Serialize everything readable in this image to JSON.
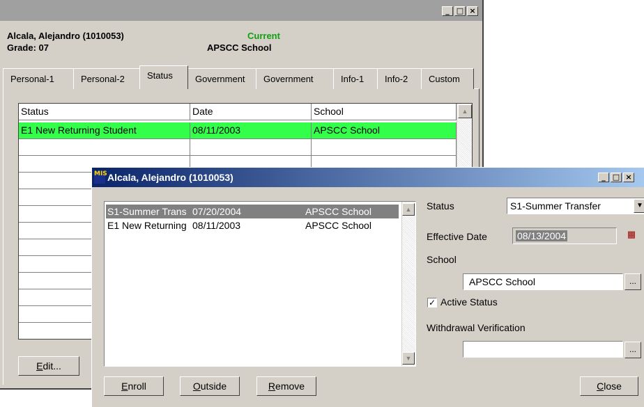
{
  "back_window": {
    "student_name": "Alcala, Alejandro  (1010053)",
    "grade": "Grade: 07",
    "status": "Current",
    "school": "APSCC School",
    "tabs": [
      "Personal-1",
      "Personal-2",
      "Status",
      "Government",
      "Government",
      "Info-1",
      "Info-2",
      "Custom"
    ],
    "active_tab": "Status",
    "grid": {
      "headers": [
        "Status",
        "Date",
        "School"
      ],
      "rows": [
        [
          "E1 New Returning Student",
          "08/11/2003",
          "APSCC School"
        ]
      ],
      "highlight_color": "#33ff4b"
    },
    "edit_button": {
      "underline": "E",
      "rest": "dit..."
    }
  },
  "front_window": {
    "title": "Alcala, Alejandro (1010053)",
    "list": [
      {
        "status": "S1-Summer Trans",
        "date": "07/20/2004",
        "school": "APSCC School",
        "selected": true
      },
      {
        "status": "E1 New Returning",
        "date": "08/11/2003",
        "school": "APSCC School",
        "selected": false
      }
    ],
    "form": {
      "status_label": "Status",
      "status_value": "S1-Summer Transfer",
      "effective_date_label": "Effective Date",
      "effective_date_value": "08/13/2004",
      "school_label": "School",
      "school_value": "APSCC School",
      "active_status_label": "Active Status",
      "active_status_checked": true,
      "withdrawal_label": "Withdrawal Verification",
      "withdrawal_value": ""
    },
    "buttons": {
      "enroll": {
        "underline": "E",
        "rest": "nroll"
      },
      "outside": {
        "underline": "O",
        "rest": "utside"
      },
      "remove": {
        "underline": "R",
        "rest": "emove"
      },
      "close": {
        "underline": "C",
        "rest": "lose"
      }
    }
  },
  "icons": {
    "minimize": "minimize-icon",
    "maximize": "maximize-icon",
    "close": "close-icon",
    "scroll_up": "arrow-up-icon",
    "scroll_down": "arrow-down-icon",
    "dropdown": "chevron-down-icon",
    "calendar": "calendar-icon",
    "browse": "ellipsis-icon"
  },
  "colors": {
    "title_active_start": "#0a246a",
    "title_active_end": "#a6caf0",
    "title_inactive": "#a0a0a0",
    "face": "#d4d0c8",
    "selected_row": "#808080"
  }
}
